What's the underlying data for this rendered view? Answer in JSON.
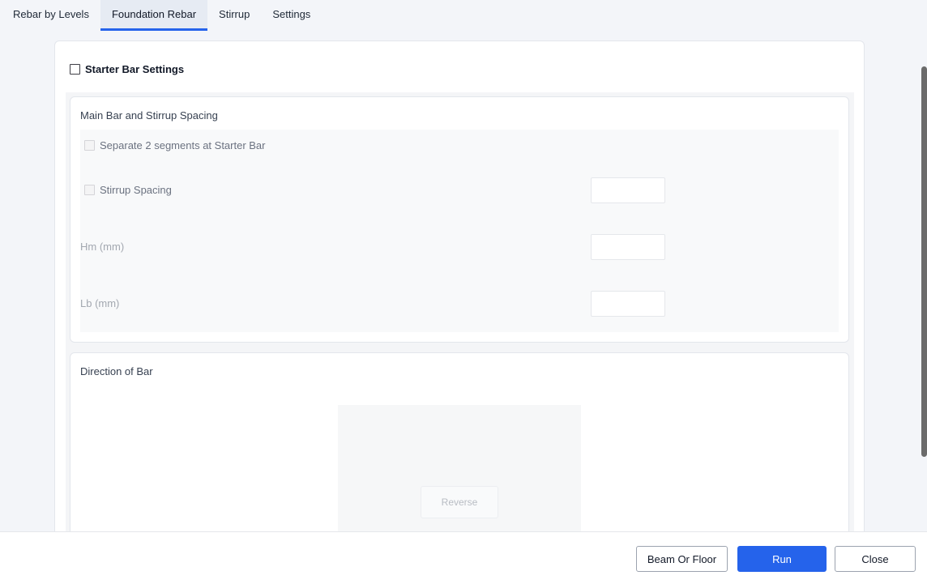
{
  "tabs": [
    {
      "label": "Rebar by Levels",
      "active": false
    },
    {
      "label": "Foundation Rebar",
      "active": true
    },
    {
      "label": "Stirrup",
      "active": false
    },
    {
      "label": "Settings",
      "active": false
    }
  ],
  "starter": {
    "label": "Starter Bar Settings",
    "checked": false
  },
  "main_group": {
    "title": "Main Bar and Stirrup Spacing",
    "separate_label": "Separate 2 segments at Starter Bar",
    "stirrup_label": "Stirrup Spacing",
    "stirrup_value": "",
    "hm_label": "Hm (mm)",
    "hm_value": "",
    "lb_label": "Lb (mm)",
    "lb_value": ""
  },
  "direction_group": {
    "title": "Direction of Bar",
    "reverse_label": "Reverse"
  },
  "footer": {
    "beam_label": "Beam Or Floor",
    "run_label": "Run",
    "close_label": "Close"
  },
  "colors": {
    "accent": "#2563eb"
  }
}
